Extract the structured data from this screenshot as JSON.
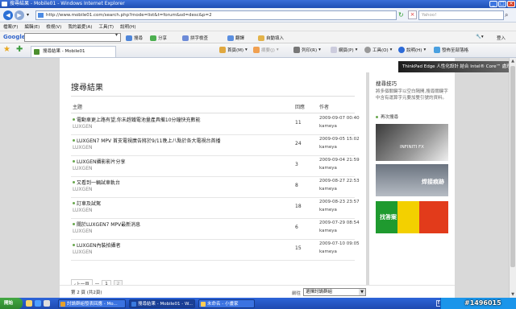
{
  "window": {
    "title": "搜尋結果 - Mobile01 - Windows Internet Explorer"
  },
  "address_bar": {
    "url": "http://www.mobile01.com/search.php?mode=list&t=forum&sd=desc&p=2",
    "search_placeholder": "Yahoo!"
  },
  "menu": [
    "檔案(F)",
    "編輯(E)",
    "檢視(V)",
    "我的最愛(A)",
    "工具(T)",
    "說明(H)"
  ],
  "google_bar": {
    "logo": "Google",
    "items": [
      {
        "label": "搜尋",
        "color": "#4f86d9"
      },
      {
        "label": "分享",
        "color": "#4caf50"
      },
      {
        "label": "拼字檢查",
        "color": "#6d8bd8"
      },
      {
        "label": "翻譯",
        "color": "#5b8fe0"
      },
      {
        "label": "自動填入",
        "color": "#e3b34a"
      }
    ],
    "signin": "登入"
  },
  "tab": {
    "label": "搜尋結果 - Mobile01"
  },
  "toolbar": {
    "home": "首頁(M)",
    "feeds": "摘要(J)",
    "print": "列印(R)",
    "page": "網頁(P)",
    "tools": "工具(O)",
    "help": "說明(H)",
    "send": "發佈至部落格"
  },
  "top_banner": {
    "text": "ThinkPad Edge 人性化設計 結合 Intel® Core™ 處理器"
  },
  "main": {
    "heading": "搜尋結果",
    "columns": {
      "topic": "主題",
      "replies": "回應",
      "author": "作者"
    },
    "rows": [
      {
        "title": "電動車更上路有望,你未趕鐵電池量產具備10分鐘快充數能",
        "forum": "LUXGEN",
        "replies": "11",
        "date": "2009-09-07 00:40",
        "author": "kameya"
      },
      {
        "title": "LUXGEN7 MPV 首支電視廣告將於9/11晚上八點於各大電視台首播",
        "forum": "LUXGEN",
        "replies": "24",
        "date": "2009-09-05 15:02",
        "author": "kameya"
      },
      {
        "title": "LUXGEN攝影影片分享",
        "forum": "LUXGEN",
        "replies": "3",
        "date": "2009-09-04 21:59",
        "author": "kameya"
      },
      {
        "title": "又看到一輛試車軌台",
        "forum": "LUXGEN",
        "replies": "8",
        "date": "2009-08-27 22:53",
        "author": "kameya"
      },
      {
        "title": "訂車及試駕",
        "forum": "LUXGEN",
        "replies": "18",
        "date": "2009-08-23 23:57",
        "author": "kameya"
      },
      {
        "title": "關於LUXGEN7 MPV最新消息",
        "forum": "LUXGEN",
        "replies": "6",
        "date": "2009-07-29 08:54",
        "author": "kameya"
      },
      {
        "title": "LUXGEN內裝拍攝者",
        "forum": "LUXGEN",
        "replies": "15",
        "date": "2009-07-10 09:05",
        "author": "kameya"
      }
    ],
    "pager": {
      "prev": "‹上一頁",
      "dash": "—",
      "page1": "1",
      "page2": "2"
    }
  },
  "sidebar": {
    "heading": "搜尋技巧",
    "tip": "將多個關鍵字以空白隔開,搜尋關鍵字中含有運算字元要加雙引號的資料。",
    "back_link": "再次搜尋",
    "ads": {
      "ad1_text": "INFINITI FX",
      "ad2_text": "焊接痕跡",
      "ad3_text": "找答案"
    }
  },
  "bottom": {
    "pages": "第 2 頁 (共2頁)",
    "goto_label": "前往",
    "goto_select": "選擇討論群組"
  },
  "taskbar": {
    "start": "開始",
    "tasks": [
      {
        "label": "討論群組發表回應 - Mo...",
        "color": "#e6a02b",
        "active": false
      },
      {
        "label": "搜尋結果 - Mobile01 - W...",
        "color": "#3a7be0",
        "active": true
      },
      {
        "label": "未命名 - 小畫家",
        "color": "#ffcc55",
        "active": false
      }
    ],
    "lang": "EN",
    "watermark": "#1496015"
  }
}
